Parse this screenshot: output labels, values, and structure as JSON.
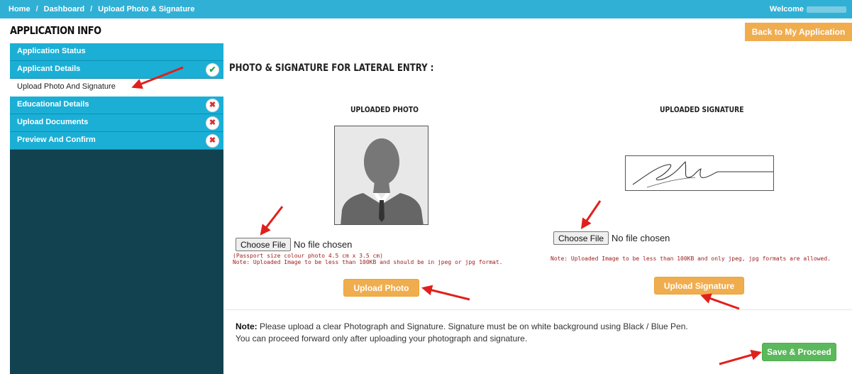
{
  "breadcrumb": {
    "home": "Home",
    "dashboard": "Dashboard",
    "current": "Upload Photo & Signature",
    "separator": "/"
  },
  "welcome": "Welcome",
  "page_title": "APPLICATION INFO",
  "back_button": "Back to My Application",
  "sidebar": {
    "items": [
      {
        "label": "Application Status",
        "status": ""
      },
      {
        "label": "Applicant Details",
        "status": "complete"
      },
      {
        "label": "Upload Photo And Signature",
        "status": ""
      },
      {
        "label": "Educational Details",
        "status": "incomplete"
      },
      {
        "label": "Upload Documents",
        "status": "incomplete"
      },
      {
        "label": "Preview And Confirm",
        "status": "incomplete"
      }
    ],
    "icons": {
      "complete": "✔",
      "incomplete": "✖"
    }
  },
  "main": {
    "title": "PHOTO & SIGNATURE FOR LATERAL ENTRY :",
    "photo": {
      "heading": "UPLOADED PHOTO",
      "choose_label": "Choose File",
      "file_status": "No file chosen",
      "note1": "(Passport size colour photo 4.5 cm x 3.5 cm)",
      "note2": "Note: Uploaded Image to be less than 100KB and should be in jpeg or jpg format.",
      "upload_button": "Upload Photo"
    },
    "signature": {
      "heading": "UPLOADED SIGNATURE",
      "choose_label": "Choose File",
      "file_status": "No file chosen",
      "note": "Note: Uploaded Image to be less than 100KB and only jpeg, jpg formats are allowed.",
      "upload_button": "Upload Signature"
    },
    "bottom_note": {
      "bold": "Note:",
      "line1": "Please upload a clear Photograph and Signature. Signature must be on white background using Black / Blue Pen.",
      "line2": "You can proceed forward only after uploading your photograph and signature."
    },
    "save_button": "Save & Proceed"
  },
  "colors": {
    "topbar": "#31b0d5",
    "sidebar_item": "#1bafd6",
    "sidebar_bg": "#12414f",
    "orange": "#f0ad4e",
    "green": "#5cb85c",
    "annotation_arrow": "#e0201c"
  }
}
